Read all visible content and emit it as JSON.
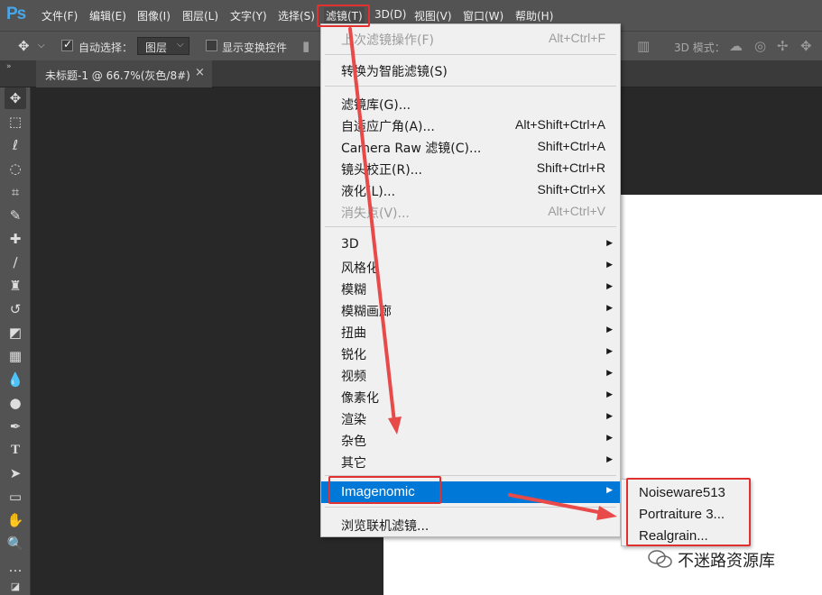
{
  "app": {
    "logo": "Ps"
  },
  "menubar": {
    "items": [
      "文件(F)",
      "编辑(E)",
      "图像(I)",
      "图层(L)",
      "文字(Y)",
      "选择(S)",
      "滤镜(T)",
      "3D(D)",
      "视图(V)",
      "窗口(W)",
      "帮助(H)"
    ]
  },
  "options": {
    "auto_select_label": "自动选择：",
    "auto_select_checked": true,
    "layer_select_value": "图层",
    "show_transform_label": "显示变换控件",
    "show_transform_checked": false,
    "mode_3d_label": "3D 模式："
  },
  "tab": {
    "title": "未标题-1 @ 66.7%(灰色/8#)",
    "close": "×"
  },
  "tools": [
    "move-tool-icon",
    "marquee-tool-icon",
    "lasso-tool-icon",
    "quick-select-tool-icon",
    "crop-tool-icon",
    "eyedropper-tool-icon",
    "healing-brush-tool-icon",
    "brush-tool-icon",
    "stamp-tool-icon",
    "history-brush-tool-icon",
    "eraser-tool-icon",
    "gradient-tool-icon",
    "blur-tool-icon",
    "dodge-tool-icon",
    "pen-tool-icon",
    "type-tool-icon",
    "path-select-tool-icon",
    "rectangle-tool-icon",
    "hand-tool-icon",
    "zoom-tool-icon",
    "more-tools-icon",
    "color-swatch-icon"
  ],
  "filter_menu": {
    "last_filter": {
      "label": "上次滤镜操作(F)",
      "shortcut": "Alt+Ctrl+F"
    },
    "smart_filter": {
      "label": "转换为智能滤镜(S)"
    },
    "group1": [
      {
        "label": "滤镜库(G)...",
        "shortcut": ""
      },
      {
        "label": "自适应广角(A)...",
        "shortcut": "Alt+Shift+Ctrl+A"
      },
      {
        "label": "Camera Raw 滤镜(C)...",
        "shortcut": "Shift+Ctrl+A"
      },
      {
        "label": "镜头校正(R)...",
        "shortcut": "Shift+Ctrl+R"
      },
      {
        "label": "液化(L)...",
        "shortcut": "Shift+Ctrl+X"
      },
      {
        "label": "消失点(V)...",
        "shortcut": "Alt+Ctrl+V"
      }
    ],
    "submenus": [
      "3D",
      "风格化",
      "模糊",
      "模糊画廊",
      "扭曲",
      "锐化",
      "视频",
      "像素化",
      "渲染",
      "杂色",
      "其它"
    ],
    "plugin": {
      "label": "Imagenomic"
    },
    "browse": {
      "label": "浏览联机滤镜..."
    }
  },
  "imagenomic_submenu": [
    "Noiseware513",
    "Portraiture 3...",
    "Realgrain..."
  ],
  "watermark": {
    "text": "不迷路资源库"
  },
  "colors": {
    "highlight": "#0078d7",
    "annotation": "#e03030",
    "menubar": "#535353",
    "canvas_bg": "#282828"
  }
}
